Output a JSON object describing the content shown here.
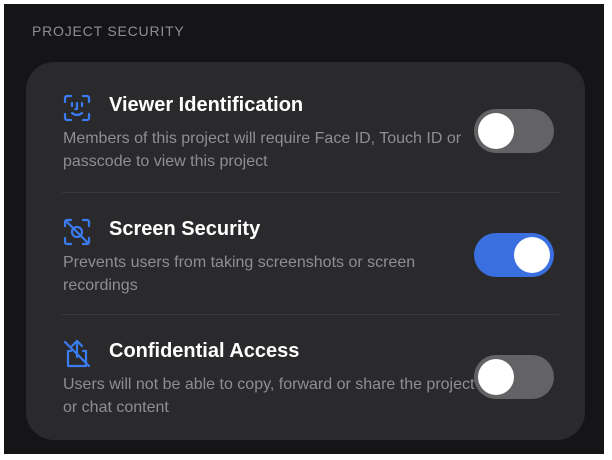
{
  "section_header": "PROJECT SECURITY",
  "colors": {
    "accent": "#3a6fe0",
    "background": "#151517",
    "card": "#2a2a2c",
    "toggle_off": "#636366",
    "secondary_text": "#8e8e93"
  },
  "settings": [
    {
      "icon": "face-id-icon",
      "title": "Viewer Identification",
      "description": "Members of this project will require Face ID, Touch ID or passcode to view this project",
      "enabled": false
    },
    {
      "icon": "screen-security-icon",
      "title": "Screen Security",
      "description": "Prevents users from taking screenshots or screen recordings",
      "enabled": true
    },
    {
      "icon": "confidential-share-off-icon",
      "title": "Confidential Access",
      "description": "Users will not be able to copy, forward or share the project or chat content",
      "enabled": false
    }
  ]
}
